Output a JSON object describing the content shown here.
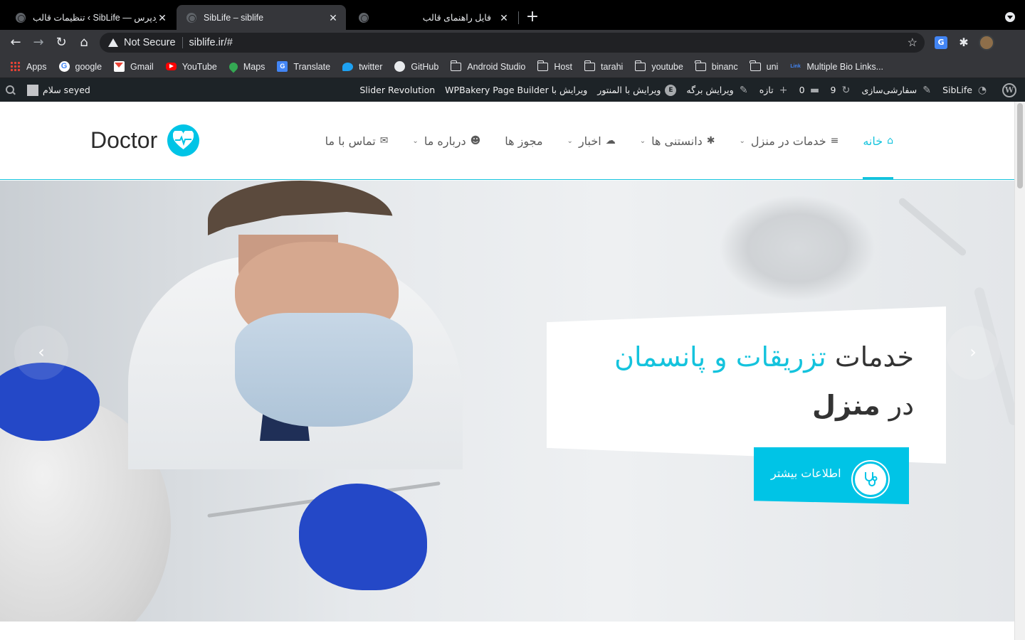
{
  "browser": {
    "tabs": [
      {
        "title": "تنظیمات قالب ‹ SibLife — وردپرس",
        "active": false
      },
      {
        "title": "SibLife – siblife",
        "active": true
      },
      {
        "title": "فایل راهنمای قالب",
        "active": false
      }
    ],
    "tab_close_glyph": "✕",
    "new_tab_glyph": "+",
    "address": {
      "security_label": "Not Secure",
      "url": "siblife.ir/#"
    },
    "nav": {
      "back": "←",
      "forward": "→",
      "reload": "↻",
      "home": "⌂"
    },
    "bookmark_star": "☆",
    "extensions": {
      "translate": "G",
      "puzzle": "✱",
      "menu": "⋮"
    }
  },
  "bookmarks": [
    {
      "label": "Apps",
      "icon": "apps-icon"
    },
    {
      "label": "google",
      "icon": "google-icon"
    },
    {
      "label": "Gmail",
      "icon": "gmail-icon"
    },
    {
      "label": "YouTube",
      "icon": "youtube-icon"
    },
    {
      "label": "Maps",
      "icon": "maps-icon"
    },
    {
      "label": "Translate",
      "icon": "translate-icon"
    },
    {
      "label": "twitter",
      "icon": "twitter-icon"
    },
    {
      "label": "GitHub",
      "icon": "github-icon"
    },
    {
      "label": "Android Studio",
      "icon": "folder-icon"
    },
    {
      "label": "Host",
      "icon": "folder-icon"
    },
    {
      "label": "tarahi",
      "icon": "folder-icon"
    },
    {
      "label": "youtube",
      "icon": "folder-icon"
    },
    {
      "label": "binanc",
      "icon": "folder-icon"
    },
    {
      "label": "uni",
      "icon": "folder-icon"
    },
    {
      "label": "Multiple Bio Links...",
      "icon": "link-icon"
    }
  ],
  "admin_bar": {
    "greeting": "سلام seyed",
    "site_name": "SibLife",
    "customize": "سفارشی‌سازی",
    "updates": "9",
    "comments": "0",
    "new": "تازه",
    "edit_page": "ویرایش برگه",
    "elementor": "ویرایش با المنتور",
    "wpbakery": "ویرایش با WPBakery Page Builder",
    "slider": "Slider Revolution",
    "elementor_badge": "E",
    "wp_logo": "W"
  },
  "site": {
    "logo_text": "Doctor",
    "accent": "#14c3dd",
    "menu": [
      {
        "label": "خانه",
        "icon": "home-icon",
        "glyph": "⌂",
        "dropdown": false,
        "active": true
      },
      {
        "label": "خدمات در منزل",
        "icon": "list-icon",
        "glyph": "≡",
        "dropdown": true,
        "active": false
      },
      {
        "label": "دانستنی ها",
        "icon": "asterisk-icon",
        "glyph": "✱",
        "dropdown": true,
        "active": false
      },
      {
        "label": "اخبار",
        "icon": "comments-icon",
        "glyph": "☁",
        "dropdown": true,
        "active": false
      },
      {
        "label": "مجوز ها",
        "icon": "",
        "glyph": "",
        "dropdown": false,
        "active": false
      },
      {
        "label": "درباره ما",
        "icon": "users-icon",
        "glyph": "☻",
        "dropdown": true,
        "active": false
      },
      {
        "label": "تماس با ما",
        "icon": "envelope-icon",
        "glyph": "✉",
        "dropdown": false,
        "active": false
      }
    ],
    "dropdown_glyph": "⌄"
  },
  "hero": {
    "title_prefix": "خدمات",
    "title_highlight": "تزریقات و پانسمان",
    "title_line2_prefix": "در",
    "title_line2_strong": "منزل",
    "cta_label": "اطلاعات بیشتر",
    "prev_glyph": "‹",
    "next_glyph": "›"
  }
}
